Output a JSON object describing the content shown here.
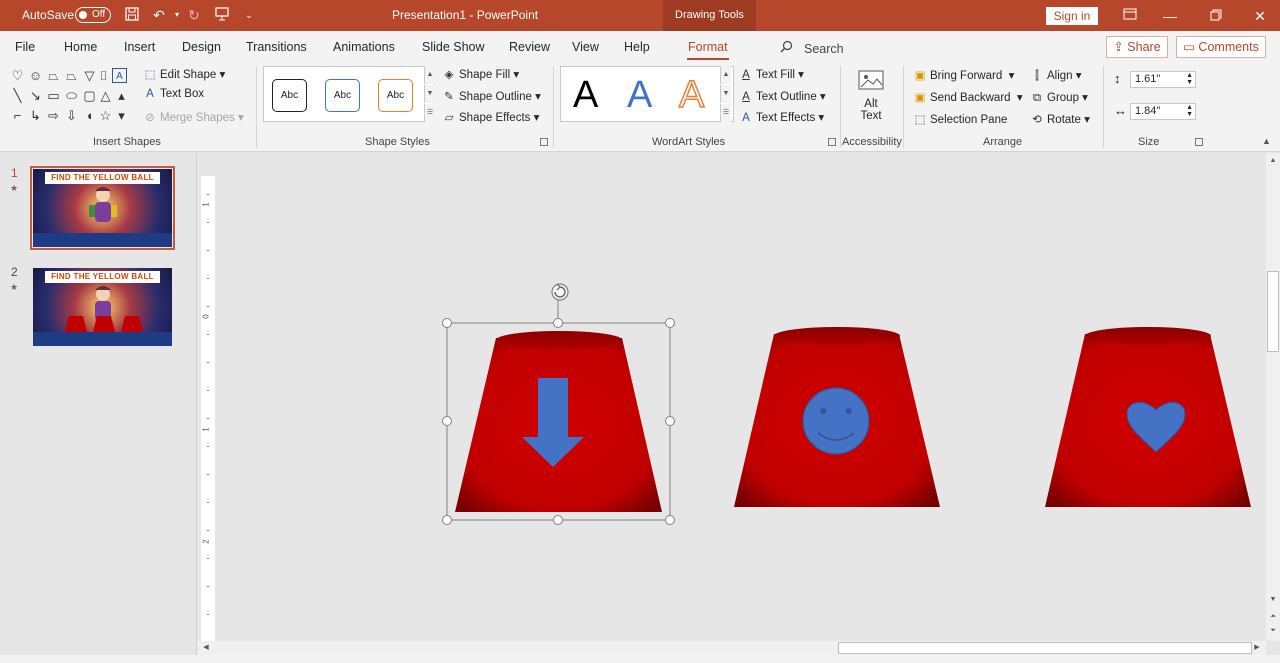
{
  "titlebar": {
    "autosave_label": "AutoSave",
    "autosave_state": "Off",
    "document_title": "Presentation1 - PowerPoint",
    "contextual_tab": "Drawing Tools",
    "signin_label": "Sign in"
  },
  "tabs": [
    "File",
    "Home",
    "Insert",
    "Design",
    "Transitions",
    "Animations",
    "Slide Show",
    "Review",
    "View",
    "Help",
    "Format"
  ],
  "active_tab": "Format",
  "search_label": "Search",
  "share_label": "Share",
  "comments_label": "Comments",
  "ribbon": {
    "insert_shapes": {
      "label": "Insert Shapes",
      "edit_shape": "Edit Shape",
      "text_box": "Text Box",
      "merge_shapes": "Merge Shapes"
    },
    "shape_styles": {
      "label": "Shape Styles",
      "preset_label": "Abc",
      "shape_fill": "Shape Fill",
      "shape_outline": "Shape Outline",
      "shape_effects": "Shape Effects"
    },
    "wordart_styles": {
      "label": "WordArt Styles",
      "preset_letter": "A",
      "text_fill": "Text Fill",
      "text_outline": "Text Outline",
      "text_effects": "Text Effects"
    },
    "accessibility": {
      "label": "Accessibility",
      "alt_text_line1": "Alt",
      "alt_text_line2": "Text"
    },
    "arrange": {
      "label": "Arrange",
      "bring_forward": "Bring Forward",
      "send_backward": "Send Backward",
      "selection_pane": "Selection Pane",
      "align": "Align",
      "group": "Group",
      "rotate": "Rotate"
    },
    "size": {
      "label": "Size",
      "height": "1.61\"",
      "width": "1.84\""
    }
  },
  "slides": [
    {
      "number": "1",
      "banner": "FIND THE YELLOW BALL"
    },
    {
      "number": "2",
      "banner": "FIND THE YELLOW BALL"
    }
  ],
  "active_slide": "1",
  "ruler_numbers": [
    "1",
    "0",
    "1",
    "2"
  ],
  "colors": {
    "accent": "#b7472a",
    "cup_red": "#c00000",
    "symbol_blue": "#4472c4"
  },
  "slide_objects": [
    "arrow-down",
    "smiley-face",
    "heart"
  ]
}
